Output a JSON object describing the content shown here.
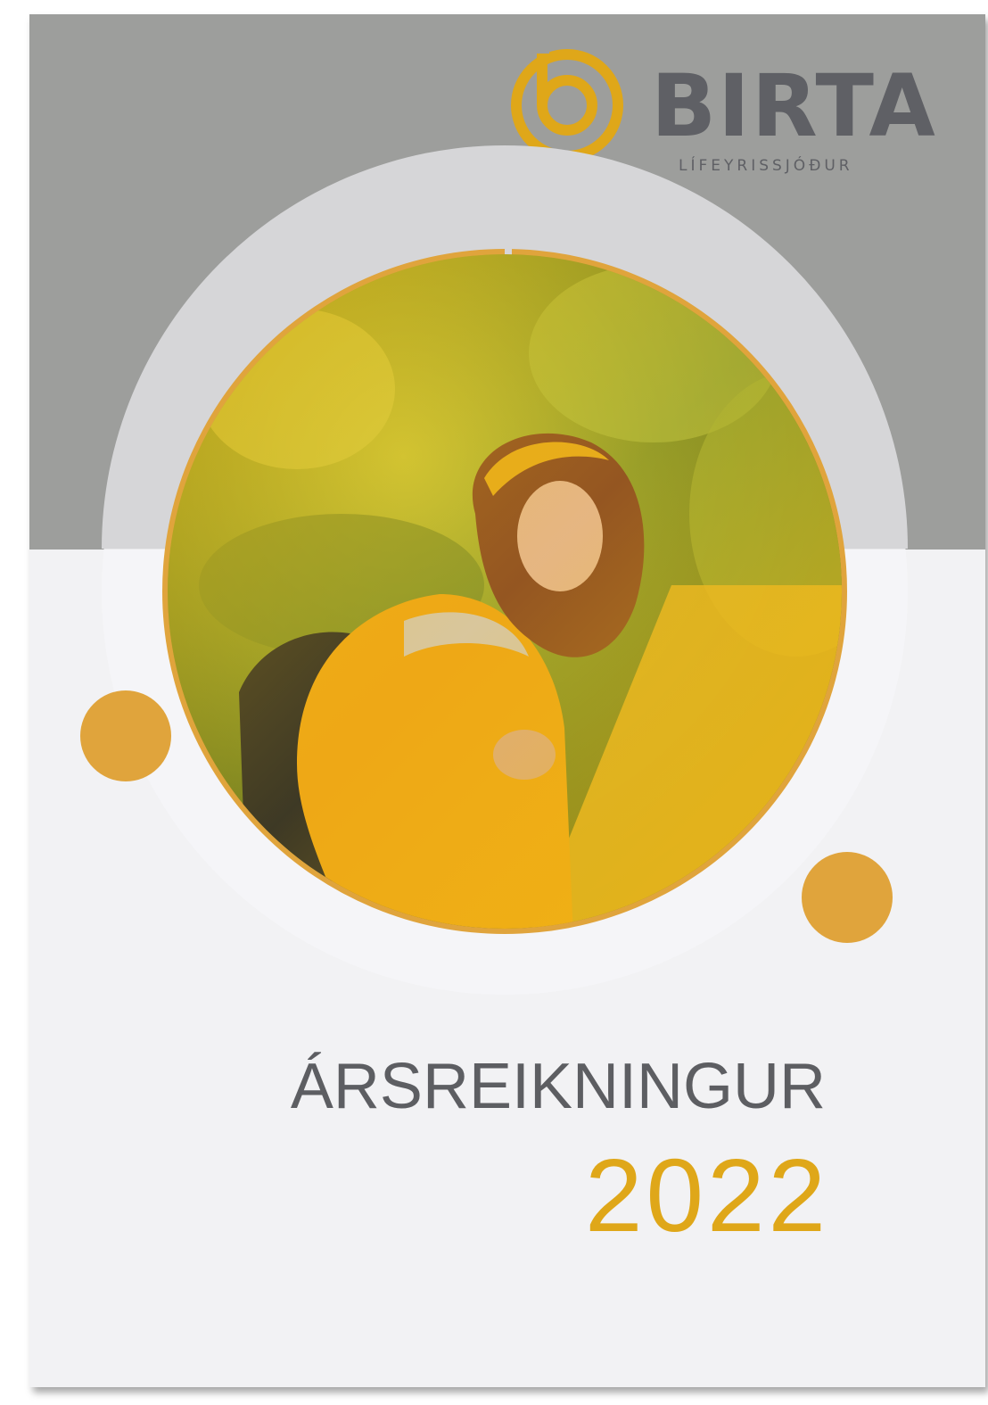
{
  "brand": {
    "name": "BIRTA",
    "subtitle": "LÍFEYRISSJÓÐUR",
    "logo_icon": "birta-b-ring-icon"
  },
  "cover": {
    "title": "ÁRSREIKNINGUR",
    "year": "2022",
    "photo": "hiker-woman-yellow-jacket-photo"
  },
  "colors": {
    "accent": "#e0a43c",
    "year_gold": "#dfa719",
    "band_gray": "#9d9e9c",
    "text_gray": "#5d5e62",
    "page_bg": "#f2f2f4"
  }
}
